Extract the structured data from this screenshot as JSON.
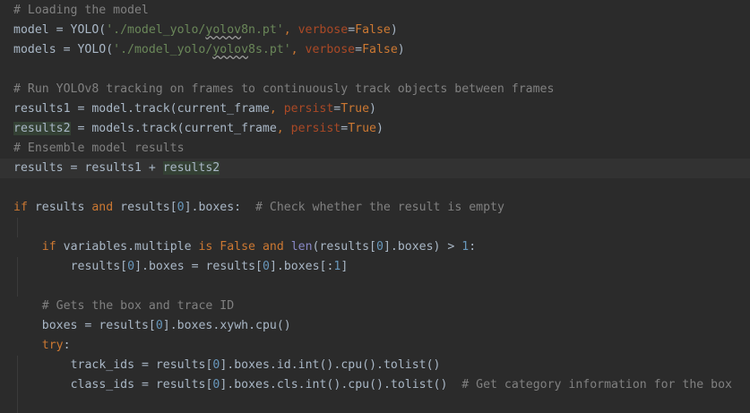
{
  "colors": {
    "background": "#2b2b2b",
    "current_line": "#323232",
    "text": "#a9b7c6",
    "comment": "#808080",
    "string": "#6a8759",
    "keyword": "#cc7832",
    "named_param": "#aa4926",
    "number": "#6897bb",
    "builtin": "#8888c6",
    "highlight": "#344134"
  },
  "editor": {
    "lines": [
      {
        "current": false,
        "guides": 0,
        "indent": 0,
        "tokens": [
          {
            "t": "# Loading the model",
            "c": "comment"
          }
        ]
      },
      {
        "current": false,
        "guides": 0,
        "indent": 0,
        "tokens": [
          {
            "t": "model = YOLO(",
            "c": "text"
          },
          {
            "t": "'./model_yolo/",
            "c": "string"
          },
          {
            "t": "yolov",
            "c": "string",
            "s": "squiggle"
          },
          {
            "t": "8n.pt'",
            "c": "string"
          },
          {
            "t": ", ",
            "c": "keyword"
          },
          {
            "t": "verbose",
            "c": "named_param"
          },
          {
            "t": "=",
            "c": "text"
          },
          {
            "t": "False",
            "c": "keyword"
          },
          {
            "t": ")",
            "c": "text"
          }
        ]
      },
      {
        "current": false,
        "guides": 0,
        "indent": 0,
        "tokens": [
          {
            "t": "models = YOLO(",
            "c": "text"
          },
          {
            "t": "'./model_yolo/",
            "c": "string"
          },
          {
            "t": "yolov",
            "c": "string",
            "s": "squiggle"
          },
          {
            "t": "8s.pt'",
            "c": "string"
          },
          {
            "t": ", ",
            "c": "keyword"
          },
          {
            "t": "verbose",
            "c": "named_param"
          },
          {
            "t": "=",
            "c": "text"
          },
          {
            "t": "False",
            "c": "keyword"
          },
          {
            "t": ")",
            "c": "text"
          }
        ]
      },
      {
        "current": false,
        "guides": 0,
        "indent": 0,
        "tokens": []
      },
      {
        "current": false,
        "guides": 0,
        "indent": 0,
        "tokens": [
          {
            "t": "# Run YOLOv8 tracking on frames to continuously track objects between frames",
            "c": "comment"
          }
        ]
      },
      {
        "current": false,
        "guides": 0,
        "indent": 0,
        "tokens": [
          {
            "t": "results1 = model.track(current_frame",
            "c": "text"
          },
          {
            "t": ", ",
            "c": "keyword"
          },
          {
            "t": "persist",
            "c": "named_param"
          },
          {
            "t": "=",
            "c": "text"
          },
          {
            "t": "True",
            "c": "keyword"
          },
          {
            "t": ")",
            "c": "text"
          }
        ]
      },
      {
        "current": false,
        "guides": 0,
        "indent": 0,
        "tokens": [
          {
            "t": "results2",
            "c": "text",
            "s": "hl"
          },
          {
            "t": " = models.track(current_frame",
            "c": "text"
          },
          {
            "t": ", ",
            "c": "keyword"
          },
          {
            "t": "persist",
            "c": "named_param"
          },
          {
            "t": "=",
            "c": "text"
          },
          {
            "t": "True",
            "c": "keyword"
          },
          {
            "t": ")",
            "c": "text"
          }
        ]
      },
      {
        "current": false,
        "guides": 0,
        "indent": 0,
        "tokens": [
          {
            "t": "# Ensemble model results",
            "c": "comment"
          }
        ]
      },
      {
        "current": true,
        "guides": 0,
        "indent": 0,
        "tokens": [
          {
            "t": "results = results1 + ",
            "c": "text"
          },
          {
            "t": "results2",
            "c": "text",
            "s": "hl"
          }
        ]
      },
      {
        "current": false,
        "guides": 0,
        "indent": 0,
        "tokens": []
      },
      {
        "current": false,
        "guides": 0,
        "indent": 0,
        "tokens": [
          {
            "t": "if ",
            "c": "keyword"
          },
          {
            "t": "results ",
            "c": "text"
          },
          {
            "t": "and ",
            "c": "keyword"
          },
          {
            "t": "results[",
            "c": "text"
          },
          {
            "t": "0",
            "c": "number"
          },
          {
            "t": "].boxes:  ",
            "c": "text"
          },
          {
            "t": "# Check whether the result is empty",
            "c": "comment"
          }
        ]
      },
      {
        "current": false,
        "guides": 1,
        "indent": 0,
        "tokens": []
      },
      {
        "current": false,
        "guides": 0,
        "indent": 4,
        "tokens": [
          {
            "t": "if ",
            "c": "keyword"
          },
          {
            "t": "variables.multiple ",
            "c": "text"
          },
          {
            "t": "is False and ",
            "c": "keyword"
          },
          {
            "t": "len",
            "c": "builtin"
          },
          {
            "t": "(results[",
            "c": "text"
          },
          {
            "t": "0",
            "c": "number"
          },
          {
            "t": "].boxes) > ",
            "c": "text"
          },
          {
            "t": "1",
            "c": "number"
          },
          {
            "t": ":",
            "c": "text"
          }
        ]
      },
      {
        "current": false,
        "guides": 1,
        "indent": 8,
        "tokens": [
          {
            "t": "results[",
            "c": "text"
          },
          {
            "t": "0",
            "c": "number"
          },
          {
            "t": "].boxes = results[",
            "c": "text"
          },
          {
            "t": "0",
            "c": "number"
          },
          {
            "t": "].boxes[:",
            "c": "text"
          },
          {
            "t": "1",
            "c": "number"
          },
          {
            "t": "]",
            "c": "text"
          }
        ]
      },
      {
        "current": false,
        "guides": 1,
        "indent": 0,
        "tokens": []
      },
      {
        "current": false,
        "guides": 0,
        "indent": 4,
        "tokens": [
          {
            "t": "# Gets the box and trace ID",
            "c": "comment"
          }
        ]
      },
      {
        "current": false,
        "guides": 0,
        "indent": 4,
        "tokens": [
          {
            "t": "boxes = results[",
            "c": "text"
          },
          {
            "t": "0",
            "c": "number"
          },
          {
            "t": "].boxes.xywh.cpu()",
            "c": "text"
          }
        ]
      },
      {
        "current": false,
        "guides": 0,
        "indent": 4,
        "tokens": [
          {
            "t": "try",
            "c": "keyword"
          },
          {
            "t": ":",
            "c": "text"
          }
        ]
      },
      {
        "current": false,
        "guides": 1,
        "indent": 8,
        "tokens": [
          {
            "t": "track_ids = results[",
            "c": "text"
          },
          {
            "t": "0",
            "c": "number"
          },
          {
            "t": "].boxes.id.int().cpu().tolist()",
            "c": "text"
          }
        ]
      },
      {
        "current": false,
        "guides": 1,
        "indent": 8,
        "tokens": [
          {
            "t": "class_ids = results[",
            "c": "text"
          },
          {
            "t": "0",
            "c": "number"
          },
          {
            "t": "].boxes.cls.int().cpu().tolist()  ",
            "c": "text"
          },
          {
            "t": "# Get category information for the box",
            "c": "comment"
          }
        ]
      },
      {
        "current": false,
        "guides": 1,
        "indent": 0,
        "tokens": []
      }
    ]
  }
}
